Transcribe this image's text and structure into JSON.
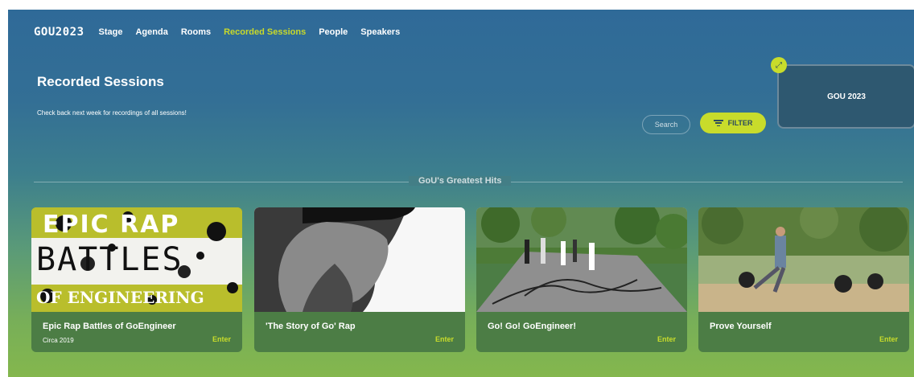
{
  "nav": {
    "logo": "GOU2023",
    "items": [
      {
        "label": "Stage"
      },
      {
        "label": "Agenda"
      },
      {
        "label": "Rooms"
      },
      {
        "label": "Recorded Sessions",
        "active": true
      },
      {
        "label": "People"
      },
      {
        "label": "Speakers"
      }
    ]
  },
  "page": {
    "title": "Recorded Sessions",
    "subtitle": "Check back next week for recordings of all sessions!"
  },
  "search": {
    "label": "Search"
  },
  "filter": {
    "label": "FILTER",
    "icon": "filter-icon"
  },
  "pip": {
    "title": "GOU 2023",
    "icon": "expand-icon"
  },
  "section": {
    "title": "GoU's Greatest Hits"
  },
  "cards": [
    {
      "title": "Epic Rap Battles of GoEngineer",
      "subtitle": "Circa 2019",
      "enter": "Enter",
      "thumb_text_1": "EPIC RAP",
      "thumb_text_2": "BATTLES",
      "thumb_text_3": "OF ENGINEERING"
    },
    {
      "title": "'The Story of Go' Rap",
      "subtitle": "",
      "enter": "Enter"
    },
    {
      "title": "Go! Go! GoEngineer!",
      "subtitle": "",
      "enter": "Enter"
    },
    {
      "title": "Prove Yourself",
      "subtitle": "",
      "enter": "Enter"
    }
  ],
  "colors": {
    "accent": "#c8dc2b",
    "card_bg": "#4c7d45"
  }
}
